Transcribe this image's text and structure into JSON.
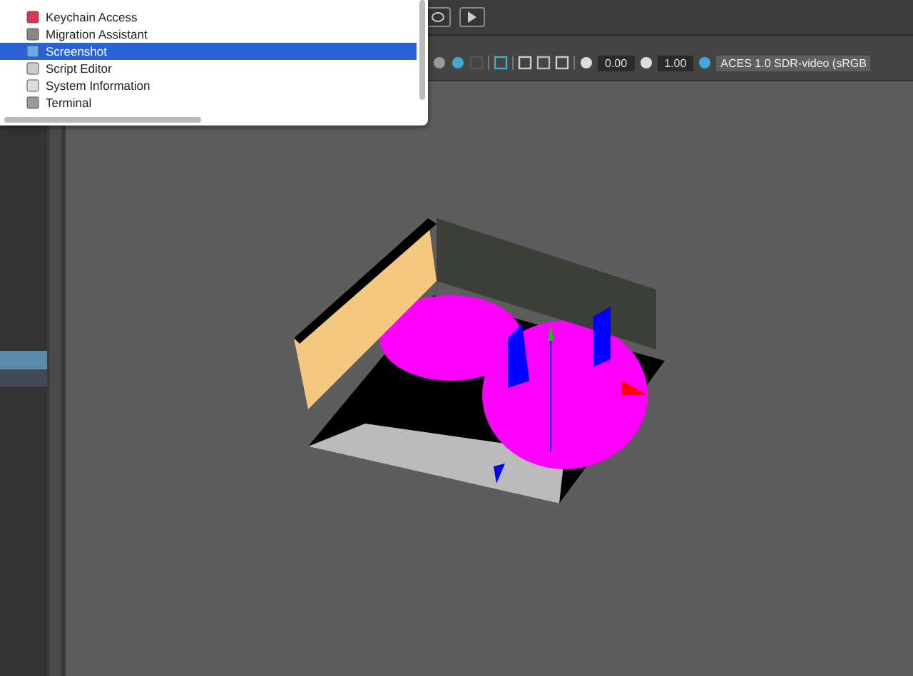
{
  "app_list": {
    "items": [
      {
        "label": "Keychain Access",
        "selected": false
      },
      {
        "label": "Migration Assistant",
        "selected": false
      },
      {
        "label": "Screenshot",
        "selected": true
      },
      {
        "label": "Script Editor",
        "selected": false
      },
      {
        "label": "System Information",
        "selected": false
      },
      {
        "label": "Terminal",
        "selected": false
      }
    ]
  },
  "viewport_toolbar": {
    "exposure": "0.00",
    "gamma": "1.00",
    "color_space": "ACES 1.0 SDR-video (sRGB"
  }
}
